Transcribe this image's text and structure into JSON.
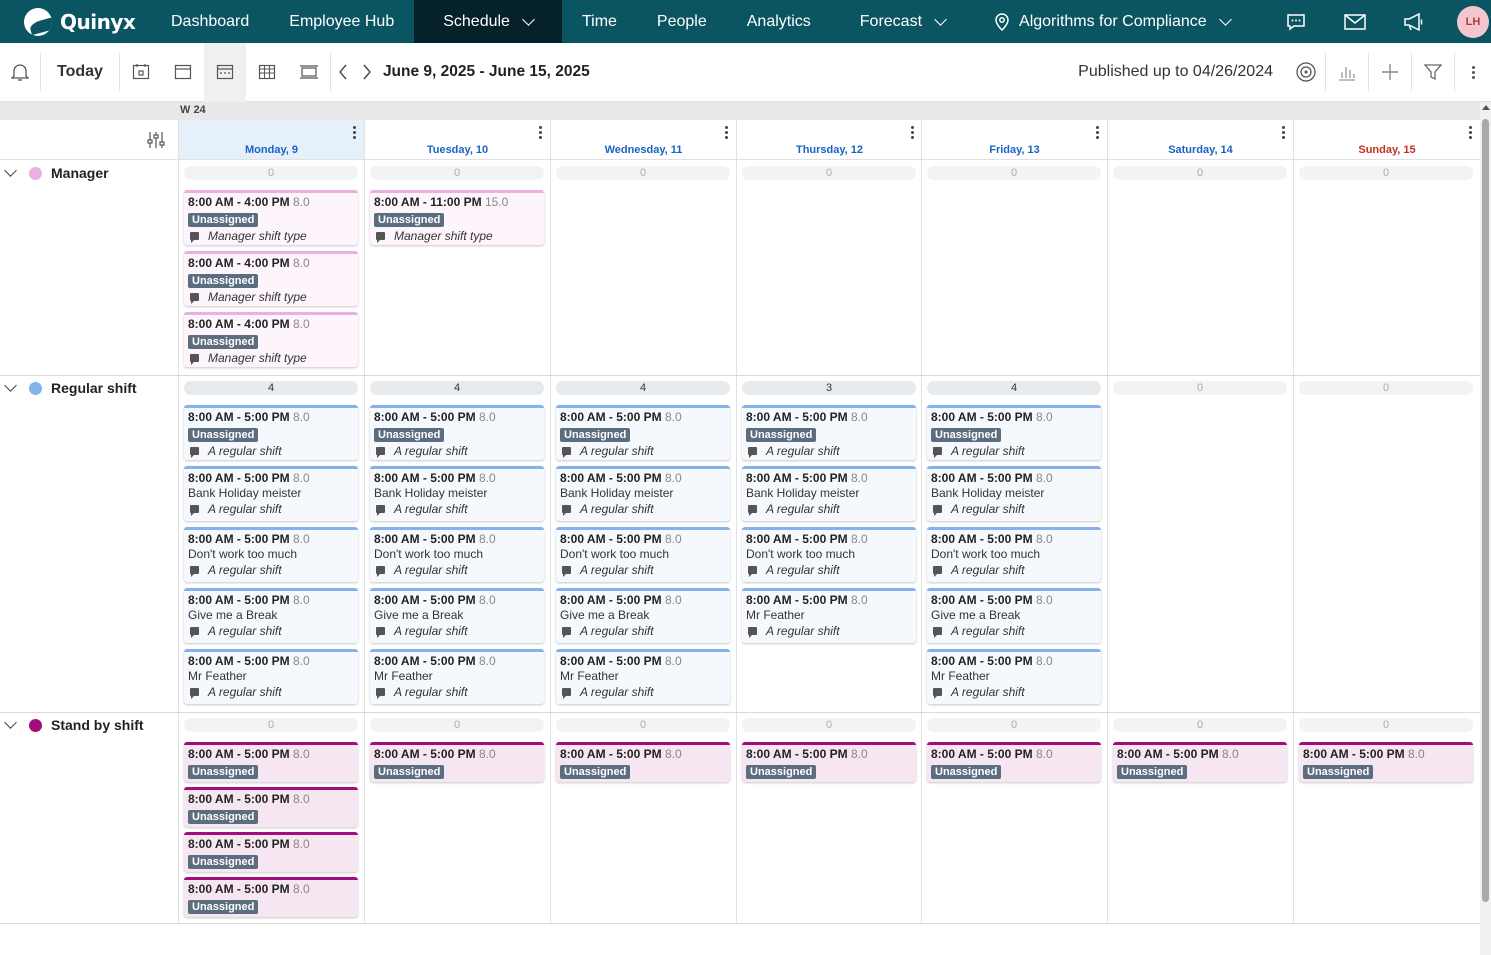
{
  "app": {
    "name": "Quinyx"
  },
  "nav": {
    "items": [
      "Dashboard",
      "Employee Hub",
      "Schedule",
      "Time",
      "People",
      "Analytics",
      "Forecast"
    ],
    "location": "Algorithms for Compliance",
    "user_initials": "LH",
    "icons": [
      "chat-icon",
      "mail-icon",
      "megaphone-icon"
    ]
  },
  "toolbar": {
    "today": "Today",
    "date_range": "June 9, 2025 - June 15, 2025",
    "published": "Published up to 04/26/2024"
  },
  "week": "W 24",
  "days": [
    "Monday, 9",
    "Tuesday, 10",
    "Wednesday, 11",
    "Thursday, 12",
    "Friday, 13",
    "Saturday, 14",
    "Sunday, 15"
  ],
  "groups": [
    {
      "name": "Manager",
      "color": "#eab0df",
      "type": "manager",
      "counts": [
        "0",
        "0",
        "0",
        "0",
        "0",
        "0",
        "0"
      ],
      "shifts": [
        [
          {
            "time": "8:00 AM - 4:00 PM",
            "hours": "8.0",
            "assignee": "Unassigned",
            "unassigned": true,
            "comment": "Manager shift type"
          },
          {
            "time": "8:00 AM - 4:00 PM",
            "hours": "8.0",
            "assignee": "Unassigned",
            "unassigned": true,
            "comment": "Manager shift type"
          },
          {
            "time": "8:00 AM - 4:00 PM",
            "hours": "8.0",
            "assignee": "Unassigned",
            "unassigned": true,
            "comment": "Manager shift type"
          }
        ],
        [
          {
            "time": "8:00 AM - 11:00 PM",
            "hours": "15.0",
            "assignee": "Unassigned",
            "unassigned": true,
            "comment": "Manager shift type"
          }
        ],
        [],
        [],
        [],
        [],
        []
      ]
    },
    {
      "name": "Regular shift",
      "color": "#86b2ec",
      "type": "regular",
      "counts": [
        "4",
        "4",
        "4",
        "3",
        "4",
        "0",
        "0"
      ],
      "shifts": [
        [
          {
            "time": "8:00 AM - 5:00 PM",
            "hours": "8.0",
            "assignee": "Unassigned",
            "unassigned": true,
            "comment": "A regular shift"
          },
          {
            "time": "8:00 AM - 5:00 PM",
            "hours": "8.0",
            "assignee": "Bank Holiday meister",
            "unassigned": false,
            "comment": "A regular shift"
          },
          {
            "time": "8:00 AM - 5:00 PM",
            "hours": "8.0",
            "assignee": "Don't work too much",
            "unassigned": false,
            "comment": "A regular shift"
          },
          {
            "time": "8:00 AM - 5:00 PM",
            "hours": "8.0",
            "assignee": "Give me a Break",
            "unassigned": false,
            "comment": "A regular shift"
          },
          {
            "time": "8:00 AM - 5:00 PM",
            "hours": "8.0",
            "assignee": "Mr Feather",
            "unassigned": false,
            "comment": "A regular shift"
          }
        ],
        [
          {
            "time": "8:00 AM - 5:00 PM",
            "hours": "8.0",
            "assignee": "Unassigned",
            "unassigned": true,
            "comment": "A regular shift"
          },
          {
            "time": "8:00 AM - 5:00 PM",
            "hours": "8.0",
            "assignee": "Bank Holiday meister",
            "unassigned": false,
            "comment": "A regular shift"
          },
          {
            "time": "8:00 AM - 5:00 PM",
            "hours": "8.0",
            "assignee": "Don't work too much",
            "unassigned": false,
            "comment": "A regular shift"
          },
          {
            "time": "8:00 AM - 5:00 PM",
            "hours": "8.0",
            "assignee": "Give me a Break",
            "unassigned": false,
            "comment": "A regular shift"
          },
          {
            "time": "8:00 AM - 5:00 PM",
            "hours": "8.0",
            "assignee": "Mr Feather",
            "unassigned": false,
            "comment": "A regular shift"
          }
        ],
        [
          {
            "time": "8:00 AM - 5:00 PM",
            "hours": "8.0",
            "assignee": "Unassigned",
            "unassigned": true,
            "comment": "A regular shift"
          },
          {
            "time": "8:00 AM - 5:00 PM",
            "hours": "8.0",
            "assignee": "Bank Holiday meister",
            "unassigned": false,
            "comment": "A regular shift"
          },
          {
            "time": "8:00 AM - 5:00 PM",
            "hours": "8.0",
            "assignee": "Don't work too much",
            "unassigned": false,
            "comment": "A regular shift"
          },
          {
            "time": "8:00 AM - 5:00 PM",
            "hours": "8.0",
            "assignee": "Give me a Break",
            "unassigned": false,
            "comment": "A regular shift"
          },
          {
            "time": "8:00 AM - 5:00 PM",
            "hours": "8.0",
            "assignee": "Mr Feather",
            "unassigned": false,
            "comment": "A regular shift"
          }
        ],
        [
          {
            "time": "8:00 AM - 5:00 PM",
            "hours": "8.0",
            "assignee": "Unassigned",
            "unassigned": true,
            "comment": "A regular shift"
          },
          {
            "time": "8:00 AM - 5:00 PM",
            "hours": "8.0",
            "assignee": "Bank Holiday meister",
            "unassigned": false,
            "comment": "A regular shift"
          },
          {
            "time": "8:00 AM - 5:00 PM",
            "hours": "8.0",
            "assignee": "Don't work too much",
            "unassigned": false,
            "comment": "A regular shift"
          },
          {
            "time": "8:00 AM - 5:00 PM",
            "hours": "8.0",
            "assignee": "Mr Feather",
            "unassigned": false,
            "comment": "A regular shift"
          }
        ],
        [
          {
            "time": "8:00 AM - 5:00 PM",
            "hours": "8.0",
            "assignee": "Unassigned",
            "unassigned": true,
            "comment": "A regular shift"
          },
          {
            "time": "8:00 AM - 5:00 PM",
            "hours": "8.0",
            "assignee": "Bank Holiday meister",
            "unassigned": false,
            "comment": "A regular shift"
          },
          {
            "time": "8:00 AM - 5:00 PM",
            "hours": "8.0",
            "assignee": "Don't work too much",
            "unassigned": false,
            "comment": "A regular shift"
          },
          {
            "time": "8:00 AM - 5:00 PM",
            "hours": "8.0",
            "assignee": "Give me a Break",
            "unassigned": false,
            "comment": "A regular shift"
          },
          {
            "time": "8:00 AM - 5:00 PM",
            "hours": "8.0",
            "assignee": "Mr Feather",
            "unassigned": false,
            "comment": "A regular shift"
          }
        ],
        [],
        []
      ]
    },
    {
      "name": "Stand by shift",
      "color": "#a10e7c",
      "type": "standby",
      "counts": [
        "0",
        "0",
        "0",
        "0",
        "0",
        "0",
        "0"
      ],
      "shifts": [
        [
          {
            "time": "8:00 AM - 5:00 PM",
            "hours": "8.0",
            "assignee": "Unassigned",
            "unassigned": true,
            "comment": ""
          },
          {
            "time": "8:00 AM - 5:00 PM",
            "hours": "8.0",
            "assignee": "Unassigned",
            "unassigned": true,
            "comment": ""
          },
          {
            "time": "8:00 AM - 5:00 PM",
            "hours": "8.0",
            "assignee": "Unassigned",
            "unassigned": true,
            "comment": ""
          },
          {
            "time": "8:00 AM - 5:00 PM",
            "hours": "8.0",
            "assignee": "Unassigned",
            "unassigned": true,
            "comment": ""
          }
        ],
        [
          {
            "time": "8:00 AM - 5:00 PM",
            "hours": "8.0",
            "assignee": "Unassigned",
            "unassigned": true,
            "comment": ""
          }
        ],
        [
          {
            "time": "8:00 AM - 5:00 PM",
            "hours": "8.0",
            "assignee": "Unassigned",
            "unassigned": true,
            "comment": ""
          }
        ],
        [
          {
            "time": "8:00 AM - 5:00 PM",
            "hours": "8.0",
            "assignee": "Unassigned",
            "unassigned": true,
            "comment": ""
          }
        ],
        [
          {
            "time": "8:00 AM - 5:00 PM",
            "hours": "8.0",
            "assignee": "Unassigned",
            "unassigned": true,
            "comment": ""
          }
        ],
        [
          {
            "time": "8:00 AM - 5:00 PM",
            "hours": "8.0",
            "assignee": "Unassigned",
            "unassigned": true,
            "comment": ""
          }
        ],
        [
          {
            "time": "8:00 AM - 5:00 PM",
            "hours": "8.0",
            "assignee": "Unassigned",
            "unassigned": true,
            "comment": ""
          }
        ]
      ]
    }
  ]
}
